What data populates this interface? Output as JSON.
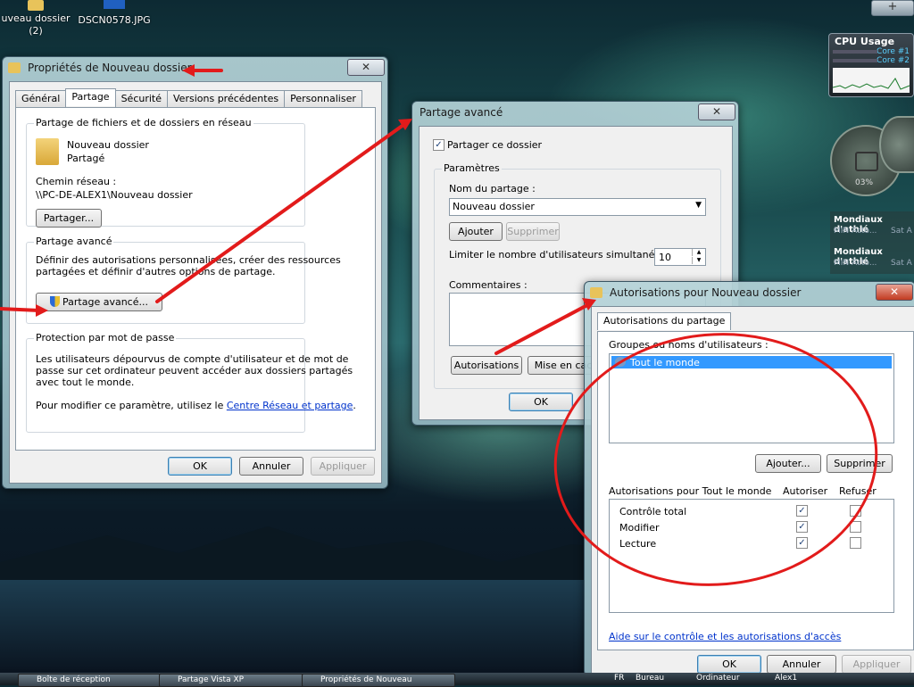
{
  "desktop": {
    "icons": [
      {
        "label": "uveau dossier\n(2)"
      },
      {
        "label": "DSCN0578.JPG"
      }
    ],
    "cpu_gadget": {
      "title": "CPU Usage",
      "core1": "Core #1",
      "core2": "Core #2",
      "percent": "03%"
    },
    "news_gadget": {
      "items": [
        "Mondiaux d'athlé",
        "MIN Acto...",
        "Sat A",
        "Mondiaux d'athlé",
        "MIN Acto...",
        "Sat A"
      ]
    },
    "top_plus": "+"
  },
  "props_window": {
    "title": "Propriétés de Nouveau dossier",
    "tabs": [
      "Général",
      "Partage",
      "Sécurité",
      "Versions précédentes",
      "Personnaliser"
    ],
    "active_tab": "Partage",
    "network_group": {
      "title": "Partage de fichiers et de dossiers en réseau",
      "folder_name": "Nouveau dossier",
      "folder_status": "Partagé",
      "path_label": "Chemin réseau :",
      "path_value": "\\\\PC-DE-ALEX1\\Nouveau dossier",
      "share_button": "Partager..."
    },
    "advanced_group": {
      "title": "Partage avancé",
      "desc_line1": "Définir des autorisations personnalisées, créer des ressources",
      "desc_line2": "partagées et définir d'autres options de partage.",
      "button": "Partage avancé..."
    },
    "password_group": {
      "title": "Protection par mot de passe",
      "desc_line1": "Les utilisateurs dépourvus de compte d'utilisateur et de mot de",
      "desc_line2": "passe sur cet ordinateur peuvent accéder aux dossiers partagés",
      "desc_line3": "avec tout le monde.",
      "change_prefix": "Pour modifier ce paramètre, utilisez le ",
      "change_link": "Centre Réseau et partage",
      "change_suffix": "."
    },
    "buttons": {
      "ok": "OK",
      "cancel": "Annuler",
      "apply": "Appliquer"
    }
  },
  "advanced_window": {
    "title": "Partage avancé",
    "share_checkbox": "Partager ce dossier",
    "params_title": "Paramètres",
    "share_name_label": "Nom du partage :",
    "share_name_value": "Nouveau dossier",
    "add_button": "Ajouter",
    "remove_button": "Supprimer",
    "limit_label": "Limiter le nombre d'utilisateurs simultanés à :",
    "limit_value": "10",
    "comments_label": "Commentaires :",
    "permissions_button": "Autorisations",
    "cache_button": "Mise en cac",
    "ok_button": "OK"
  },
  "perm_window": {
    "title": "Autorisations pour Nouveau dossier",
    "tab": "Autorisations du partage",
    "groups_label": "Groupes ou noms d'utilisateurs :",
    "users": [
      "Tout le monde"
    ],
    "add_button": "Ajouter...",
    "remove_button": "Supprimer",
    "perm_header": "Autorisations pour Tout le monde",
    "allow_header": "Autoriser",
    "deny_header": "Refuser",
    "permissions": [
      {
        "name": "Contrôle total",
        "allow": true,
        "deny": false
      },
      {
        "name": "Modifier",
        "allow": true,
        "deny": false
      },
      {
        "name": "Lecture",
        "allow": true,
        "deny": false
      }
    ],
    "help_link": "Aide sur le contrôle et les autorisations d'accès",
    "buttons": {
      "ok": "OK",
      "cancel": "Annuler",
      "apply": "Appliquer"
    }
  },
  "taskbar": {
    "items": [
      "Boîte de réception",
      "Partage Vista XP",
      "Propriétés de Nouveau"
    ],
    "tray": [
      "FR",
      "Bureau",
      "Ordinateur",
      "Alex1"
    ]
  },
  "colors": {
    "accent_red": "#e21b1b",
    "selection": "#3399ff"
  }
}
